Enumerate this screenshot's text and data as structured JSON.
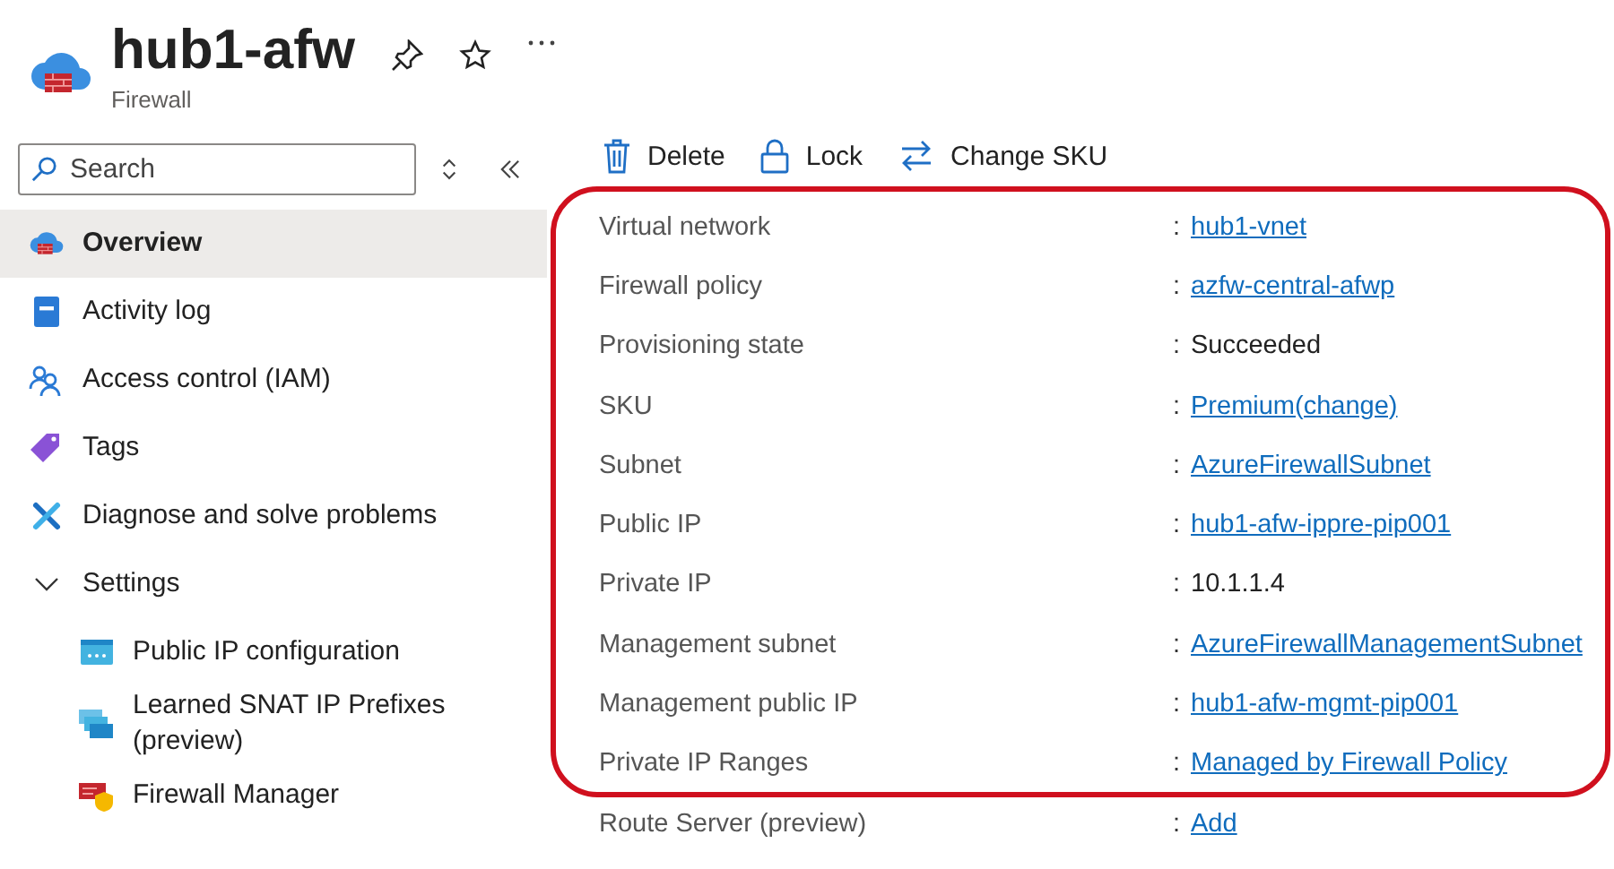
{
  "header": {
    "title": "hub1-afw",
    "subtitle": "Firewall"
  },
  "sidebar": {
    "search": {
      "placeholder": "Search"
    },
    "items": [
      {
        "label": "Overview",
        "selected": true
      },
      {
        "label": "Activity log",
        "selected": false
      },
      {
        "label": "Access control (IAM)",
        "selected": false
      },
      {
        "label": "Tags",
        "selected": false
      },
      {
        "label": "Diagnose and solve problems",
        "selected": false
      },
      {
        "label": "Settings",
        "expanded": true,
        "selected": false,
        "children": [
          {
            "label": "Public IP configuration",
            "selected": false
          },
          {
            "label": "Learned SNAT IP Prefixes (preview)",
            "selected": false
          },
          {
            "label": "Firewall Manager",
            "selected": false
          }
        ]
      }
    ]
  },
  "toolbar": [
    {
      "label": "Delete"
    },
    {
      "label": "Lock"
    },
    {
      "label": "Change SKU"
    }
  ],
  "properties": [
    {
      "label": "Virtual network",
      "separator": ":",
      "value": "hub1-vnet",
      "link": true
    },
    {
      "label": "Firewall policy",
      "separator": ":",
      "value": "azfw-central-afwp",
      "link": true
    },
    {
      "label": "Provisioning state",
      "separator": ":",
      "value": "Succeeded",
      "link": false
    },
    {
      "label": "SKU",
      "separator": ":",
      "value": "Premium(change)",
      "link": true
    },
    {
      "label": "Subnet",
      "separator": ":",
      "value": "AzureFirewallSubnet",
      "link": true
    },
    {
      "label": "Public IP",
      "separator": ":",
      "value": "hub1-afw-ippre-pip001",
      "link": true
    },
    {
      "label": "Private IP",
      "separator": ":",
      "value": "10.1.1.4",
      "link": false
    },
    {
      "label": "Management subnet",
      "separator": ":",
      "value": "AzureFirewallManagementSubnet",
      "link": true
    },
    {
      "label": "Management public IP",
      "separator": ":",
      "value": "hub1-afw-mgmt-pip001",
      "link": true
    },
    {
      "label": "Private IP Ranges",
      "separator": ":",
      "value": "Managed by Firewall Policy",
      "link": true
    },
    {
      "label": "Route Server (preview)",
      "separator": ":",
      "value": "Add",
      "link": true
    }
  ]
}
